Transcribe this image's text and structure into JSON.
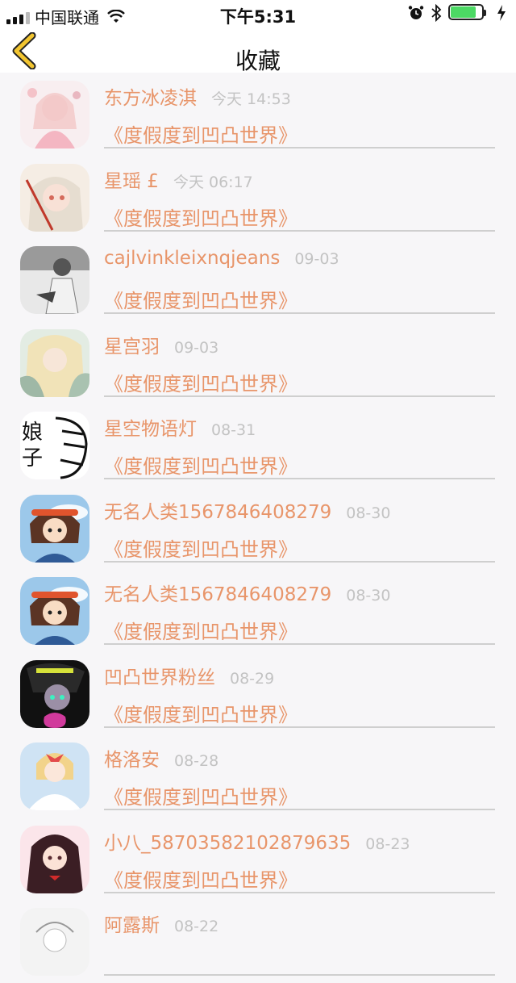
{
  "status_bar": {
    "carrier": "中国联通",
    "time": "下午5:31",
    "signal_bars_filled": 3,
    "battery_level": 0.85,
    "icons": [
      "signal-icon",
      "wifi-icon",
      "alarm-icon",
      "bluetooth-icon",
      "battery-icon",
      "charging-icon"
    ]
  },
  "nav": {
    "title": "收藏",
    "back_icon": "chevron-left-icon",
    "accent_color": "#f2c530"
  },
  "colors": {
    "name": "#e8956a",
    "title": "#e8956a",
    "time": "#c3c3c3"
  },
  "items": [
    {
      "name": "东方冰凌淇",
      "time": "今天 14:53",
      "title": "《度假度到凹凸世界》"
    },
    {
      "name": "星瑶 £",
      "time": "今天 06:17",
      "title": "《度假度到凹凸世界》"
    },
    {
      "name": "cajlvinkleixnqjeans",
      "time": "09-03",
      "title": "《度假度到凹凸世界》"
    },
    {
      "name": "星宫羽",
      "time": "09-03",
      "title": "《度假度到凹凸世界》"
    },
    {
      "name": "星空物语灯",
      "time": "08-31",
      "title": "《度假度到凹凸世界》"
    },
    {
      "name": "无名人类1567846408279",
      "time": "08-30",
      "title": "《度假度到凹凸世界》"
    },
    {
      "name": "无名人类1567846408279",
      "time": "08-30",
      "title": "《度假度到凹凸世界》"
    },
    {
      "name": "凹凸世界粉丝",
      "time": "08-29",
      "title": "《度假度到凹凸世界》"
    },
    {
      "name": "格洛安",
      "time": "08-28",
      "title": "《度假度到凹凸世界》"
    },
    {
      "name": "小八_58703582102879635",
      "time": "08-23",
      "title": "《度假度到凹凸世界》"
    },
    {
      "name": "阿露斯",
      "time": "08-22",
      "title": ""
    }
  ]
}
